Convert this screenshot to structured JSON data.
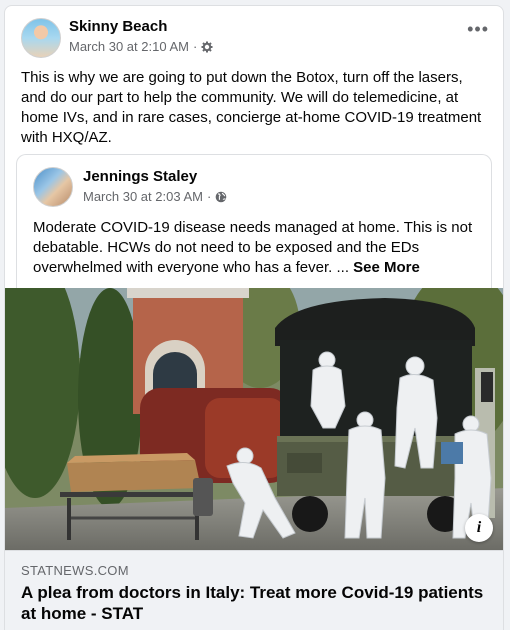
{
  "post": {
    "author": "Skinny Beach",
    "timestamp": "March 30 at 2:10 AM",
    "separator": "·",
    "audience_icon": "gear-icon",
    "more_label": "•••",
    "text": "This is why we are going to put down the Botox, turn off the lasers, and do our part to help the community. We will do telemedicine, at home IVs, and in rare cases, concierge at-home COVID-19 treatment with HXQ/AZ."
  },
  "shared_post": {
    "author": "Jennings Staley",
    "timestamp": "March 30 at 2:03 AM",
    "separator": "·",
    "audience_icon": "globe-icon",
    "text": "Moderate COVID-19 disease needs managed at home.  This is not debatable.  HCWs do not need to be exposed and the EDs overwhelmed with everyone who has a fever. ...",
    "see_more": "See More"
  },
  "link": {
    "domain": "STATNEWS.COM",
    "title": "A plea from doctors in Italy: Treat more Covid-19 patients at home - STAT",
    "info_label": "i"
  }
}
